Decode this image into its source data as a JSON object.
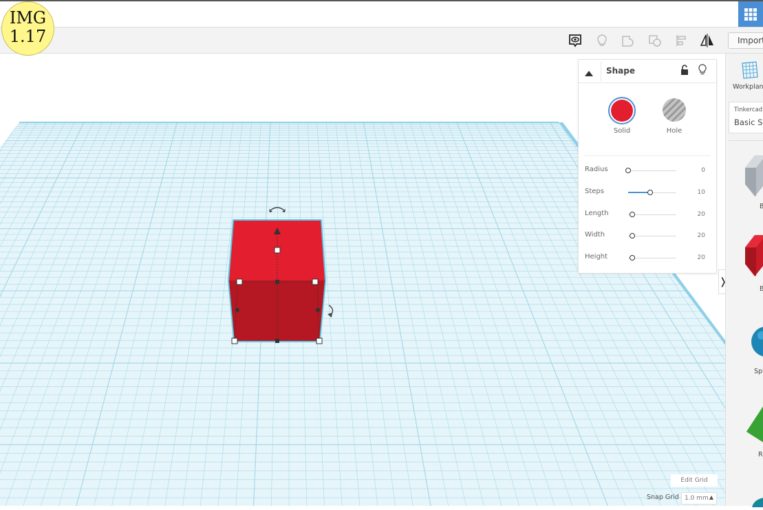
{
  "badge": {
    "line1": "IMG",
    "line2": "1.17"
  },
  "toolbar": {
    "import_label": "Import",
    "icons": [
      "note-view-icon",
      "light-bulb-icon",
      "group-icon",
      "ungroup-icon",
      "align-icon",
      "mirror-icon"
    ]
  },
  "shape_panel": {
    "title": "Shape",
    "solid_label": "Solid",
    "hole_label": "Hole",
    "solid_color": "#e31e2f",
    "params": [
      {
        "label": "Radius",
        "value": "0",
        "fraction": 0
      },
      {
        "label": "Steps",
        "value": "10",
        "fraction": 0.45
      },
      {
        "label": "Length",
        "value": "20",
        "fraction": 0.08
      },
      {
        "label": "Width",
        "value": "20",
        "fraction": 0.08
      },
      {
        "label": "Height",
        "value": "20",
        "fraction": 0.08
      }
    ]
  },
  "right_panel": {
    "workplane_label": "Workplane",
    "library_source": "Tinkercad",
    "library_name": "Basic Sh",
    "shape_labels": [
      "B",
      "B",
      "Spl",
      "R"
    ]
  },
  "grid": {
    "edit_label": "Edit Grid",
    "snap_label": "Snap Grid",
    "snap_value": "1.0 mm"
  },
  "colors": {
    "accent": "#4a8fd6",
    "grid_line": "#a6d8e8",
    "cube_front": "#b51822",
    "cube_top": "#e31e2f",
    "selection": "#5ac8e6"
  }
}
